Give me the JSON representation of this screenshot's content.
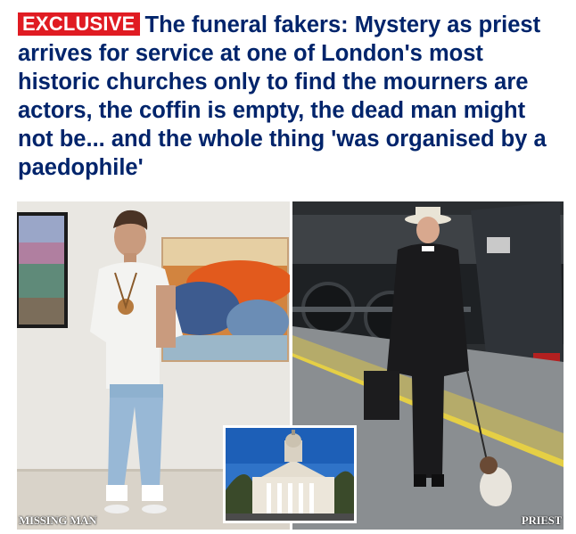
{
  "article": {
    "badge": "EXCLUSIVE",
    "headline": "The funeral fakers: Mystery as priest arrives for service at one of London's most historic churches only to find the mourners are actors, the coffin is empty, the dead man might not be... and the whole thing 'was organised by a paedophile'"
  },
  "photos": {
    "left_caption": "MISSING MAN",
    "right_caption": "PRIEST"
  },
  "colors": {
    "badge_bg": "#e01b22",
    "headline": "#00246b"
  }
}
